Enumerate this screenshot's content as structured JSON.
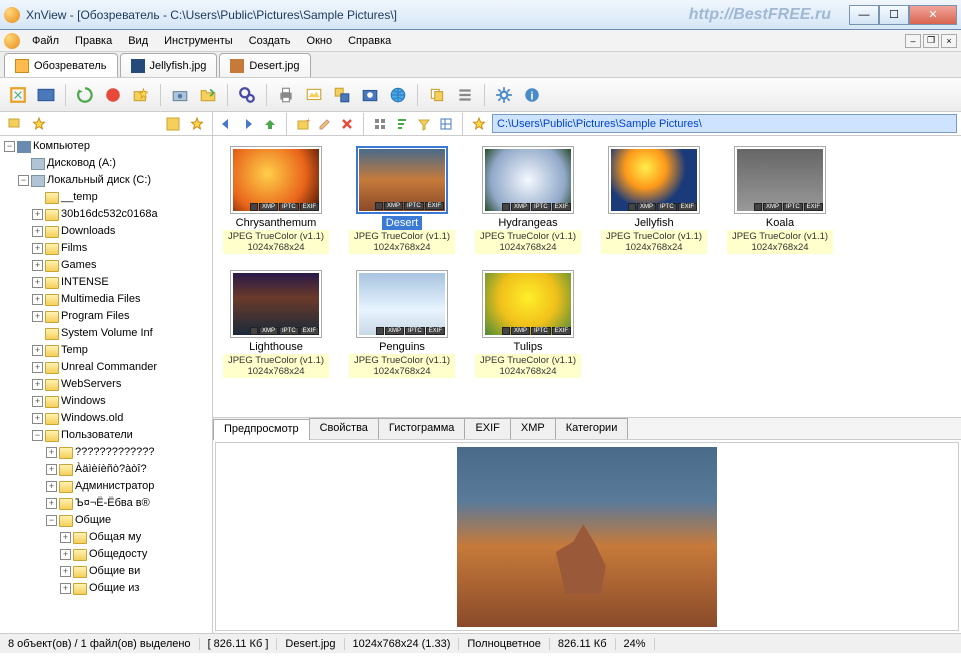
{
  "window": {
    "title": "XnView - [Обозреватель - C:\\Users\\Public\\Pictures\\Sample Pictures\\]",
    "watermark": "http://BestFREE.ru"
  },
  "menu": {
    "items": [
      "Файл",
      "Правка",
      "Вид",
      "Инструменты",
      "Создать",
      "Окно",
      "Справка"
    ]
  },
  "tabs": {
    "items": [
      {
        "label": "Обозреватель",
        "active": true,
        "icon": "browser"
      },
      {
        "label": "Jellyfish.jpg",
        "active": false,
        "icon": "jelly"
      },
      {
        "label": "Desert.jpg",
        "active": false,
        "icon": "desert"
      }
    ]
  },
  "address": {
    "path": "C:\\Users\\Public\\Pictures\\Sample Pictures\\"
  },
  "tree": {
    "root": "Компьютер",
    "drives": [
      {
        "label": "Дисковод (A:)",
        "expandable": false,
        "icon": "drive"
      },
      {
        "label": "Локальный диск (C:)",
        "expandable": true,
        "expanded": true,
        "icon": "drive",
        "children": [
          {
            "label": "__temp",
            "exp": "none"
          },
          {
            "label": "30b16dc532c0168a",
            "exp": "plus"
          },
          {
            "label": "Downloads",
            "exp": "plus"
          },
          {
            "label": "Films",
            "exp": "plus"
          },
          {
            "label": "Games",
            "exp": "plus"
          },
          {
            "label": "INTENSE",
            "exp": "plus"
          },
          {
            "label": "Multimedia Files",
            "exp": "plus"
          },
          {
            "label": "Program Files",
            "exp": "plus"
          },
          {
            "label": "System Volume Inf",
            "exp": "none"
          },
          {
            "label": "Temp",
            "exp": "plus"
          },
          {
            "label": "Unreal Commander",
            "exp": "plus"
          },
          {
            "label": "WebServers",
            "exp": "plus"
          },
          {
            "label": "Windows",
            "exp": "plus"
          },
          {
            "label": "Windows.old",
            "exp": "plus"
          },
          {
            "label": "Пользователи",
            "exp": "minus",
            "children": [
              {
                "label": "?????????????",
                "exp": "plus"
              },
              {
                "label": "Àäìèíèñò?àòî?",
                "exp": "plus"
              },
              {
                "label": "Администратор",
                "exp": "plus"
              },
              {
                "label": "Ъ¤¬Ё-Ёбва в®",
                "exp": "plus"
              },
              {
                "label": "Общие",
                "exp": "minus",
                "children": [
                  {
                    "label": "Общая му",
                    "exp": "plus"
                  },
                  {
                    "label": "Общедосту",
                    "exp": "plus"
                  },
                  {
                    "label": "Общие ви",
                    "exp": "plus"
                  },
                  {
                    "label": "Общие из",
                    "exp": "plus"
                  }
                ]
              }
            ]
          }
        ]
      }
    ]
  },
  "thumbs": [
    {
      "name": "Chrysanthemum",
      "info1": "JPEG TrueColor (v1.1)",
      "info2": "1024x768x24",
      "cls": "chrys",
      "selected": false
    },
    {
      "name": "Desert",
      "info1": "JPEG TrueColor (v1.1)",
      "info2": "1024x768x24",
      "cls": "desert",
      "selected": true
    },
    {
      "name": "Hydrangeas",
      "info1": "JPEG TrueColor (v1.1)",
      "info2": "1024x768x24",
      "cls": "hydra",
      "selected": false
    },
    {
      "name": "Jellyfish",
      "info1": "JPEG TrueColor (v1.1)",
      "info2": "1024x768x24",
      "cls": "jelly",
      "selected": false
    },
    {
      "name": "Koala",
      "info1": "JPEG TrueColor (v1.1)",
      "info2": "1024x768x24",
      "cls": "koala",
      "selected": false
    },
    {
      "name": "Lighthouse",
      "info1": "JPEG TrueColor (v1.1)",
      "info2": "1024x768x24",
      "cls": "light",
      "selected": false
    },
    {
      "name": "Penguins",
      "info1": "JPEG TrueColor (v1.1)",
      "info2": "1024x768x24",
      "cls": "peng",
      "selected": false
    },
    {
      "name": "Tulips",
      "info1": "JPEG TrueColor (v1.1)",
      "info2": "1024x768x24",
      "cls": "tulip",
      "selected": false
    }
  ],
  "badges": [
    "XMP",
    "IPTC",
    "EXIF"
  ],
  "preview_tabs": [
    "Предпросмотр",
    "Свойства",
    "Гистограмма",
    "EXIF",
    "XMP",
    "Категории"
  ],
  "status": {
    "objects": "8 объект(ов) / 1 файл(ов) выделено",
    "size1": "[ 826.11 Кб ]",
    "filename": "Desert.jpg",
    "dims": "1024x768x24 (1.33)",
    "colormodel": "Полноцветное",
    "size2": "826.11 Кб",
    "zoom": "24%"
  }
}
